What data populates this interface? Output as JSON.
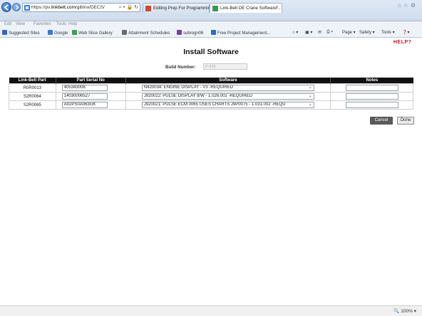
{
  "browser": {
    "url_prefix": "https://pv.",
    "url_domain": "linkbelt.com",
    "url_rest": "/gibino/DECS/",
    "tabs": [
      {
        "label": "Editing Prep For Programming...",
        "icon_color": "#d8442f"
      },
      {
        "label": "Link-Belt DE Crane Software...",
        "icon_color": "#3a9a4a"
      }
    ],
    "menu": [
      "Edit",
      "View",
      "Favorites",
      "Tools",
      "Help"
    ],
    "favorites": [
      {
        "label": "Suggested Sites",
        "icon": "star-icon",
        "color": "#2f6bc4"
      },
      {
        "label": "Google",
        "icon": "google-icon",
        "color": "#3a78d8"
      },
      {
        "label": "Web Slice Gallery",
        "icon": "slice-icon",
        "color": "#3fa04a"
      },
      {
        "label": "Attainment Schedules",
        "icon": "doc-icon",
        "color": "#6b6b6b"
      },
      {
        "label": "subrogn06",
        "icon": "folder-icon",
        "color": "#7a3fa0"
      },
      {
        "label": "Free Project Management...",
        "icon": "page-icon",
        "color": "#2f6bc4"
      }
    ],
    "commands": [
      "Page",
      "Safety",
      "Tools"
    ],
    "zoom": "100%"
  },
  "page": {
    "help": "HELP?",
    "title": "Install Software",
    "build_label": "Build Number:",
    "build_value": "P-525",
    "columns": [
      "Link-Belt Part",
      "Part Serial No",
      "Software",
      "Notes"
    ],
    "rows": [
      {
        "part": "R0R0013",
        "serial": "405343008",
        "software": "N420034: ENGINE DISPLAY - V3 -REQUIRED",
        "notes": ""
      },
      {
        "part": "S2R0064",
        "serial": "14030006527",
        "software": "J920022: PULSE DISPLAY 8/W - 1.026.002 -REQUIRED",
        "notes": ""
      },
      {
        "part": "S2R0065",
        "serial": "A02PS0A063GK",
        "software": "J920021: PULSE ECM 0065 USES CHARTS J9P0075 - 1.031.002 -REQU",
        "notes": ""
      }
    ],
    "cancel_label": "Cancel",
    "done_label": "Done"
  }
}
